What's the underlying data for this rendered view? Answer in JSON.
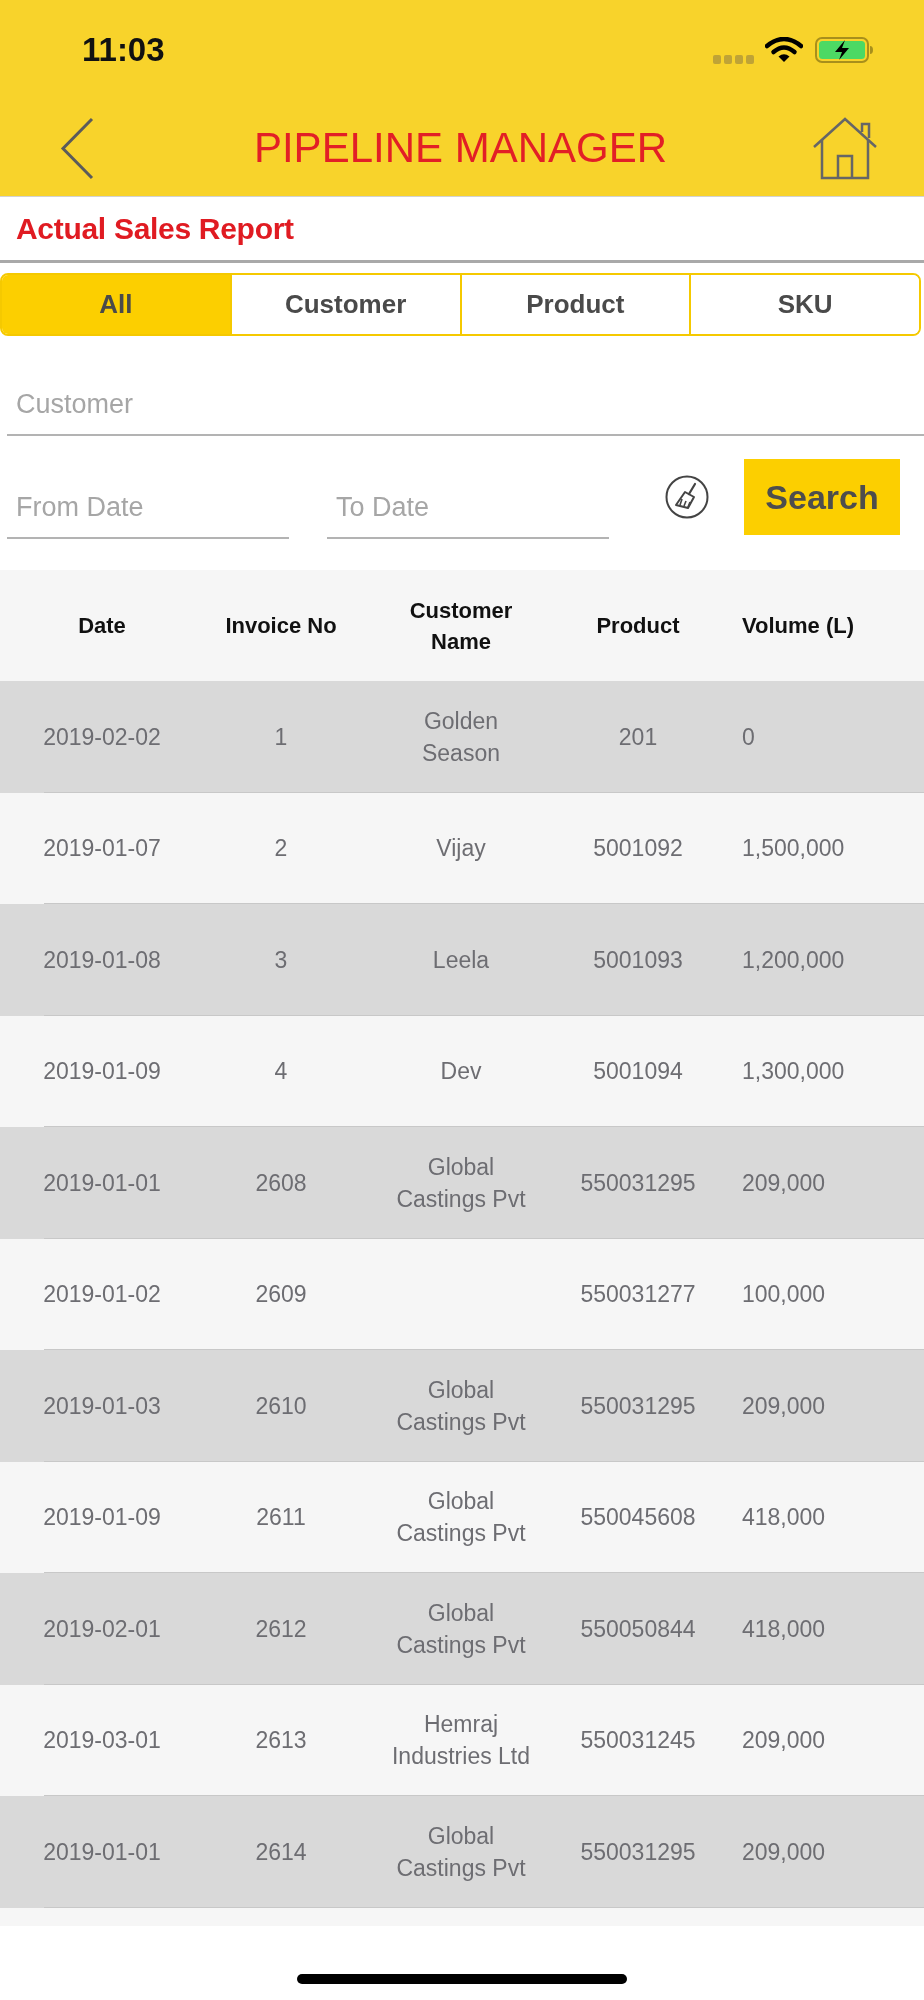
{
  "status_bar": {
    "time": "11:03"
  },
  "header": {
    "title": "PIPELINE MANAGER"
  },
  "report": {
    "title": "Actual Sales Report"
  },
  "tabs": [
    {
      "label": "All",
      "selected": true
    },
    {
      "label": "Customer",
      "selected": false
    },
    {
      "label": "Product",
      "selected": false
    },
    {
      "label": "SKU",
      "selected": false
    }
  ],
  "filters": {
    "customer_field": {
      "placeholder": "Customer"
    },
    "from_date_field": {
      "placeholder": "From Date"
    },
    "to_date_field": {
      "placeholder": "To Date"
    },
    "search_button": {
      "label": "Search"
    }
  },
  "table": {
    "columns": [
      "Date",
      "Invoice No",
      "Customer Name",
      "Product",
      "Volume (L)"
    ],
    "rows": [
      {
        "date": "2019-02-02",
        "invoice_no": "1",
        "customer_name": "Golden Season",
        "product": "201",
        "volume": "0"
      },
      {
        "date": "2019-01-07",
        "invoice_no": "2",
        "customer_name": "Vijay",
        "product": "5001092",
        "volume": "1,500,000"
      },
      {
        "date": "2019-01-08",
        "invoice_no": "3",
        "customer_name": "Leela",
        "product": "5001093",
        "volume": "1,200,000"
      },
      {
        "date": "2019-01-09",
        "invoice_no": "4",
        "customer_name": "Dev",
        "product": "5001094",
        "volume": "1,300,000"
      },
      {
        "date": "2019-01-01",
        "invoice_no": "2608",
        "customer_name": "Global Castings Pvt",
        "product": "550031295",
        "volume": "209,000"
      },
      {
        "date": "2019-01-02",
        "invoice_no": "2609",
        "product": "550031277",
        "volume": "100,000"
      },
      {
        "date": "2019-01-03",
        "invoice_no": "2610",
        "customer_name": "Global Castings Pvt",
        "product": "550031295",
        "volume": "209,000"
      },
      {
        "date": "2019-01-09",
        "invoice_no": "2611",
        "customer_name": "Global Castings Pvt",
        "product": "550045608",
        "volume": "418,000"
      },
      {
        "date": "2019-02-01",
        "invoice_no": "2612",
        "customer_name": "Global Castings Pvt",
        "product": "550050844",
        "volume": "418,000"
      },
      {
        "date": "2019-03-01",
        "invoice_no": "2613",
        "customer_name": "Hemraj Industries Ltd",
        "product": "550031245",
        "volume": "209,000"
      },
      {
        "date": "2019-01-01",
        "invoice_no": "2614",
        "customer_name": "Global Castings Pvt",
        "product": "550031295",
        "volume": "209,000"
      }
    ]
  }
}
